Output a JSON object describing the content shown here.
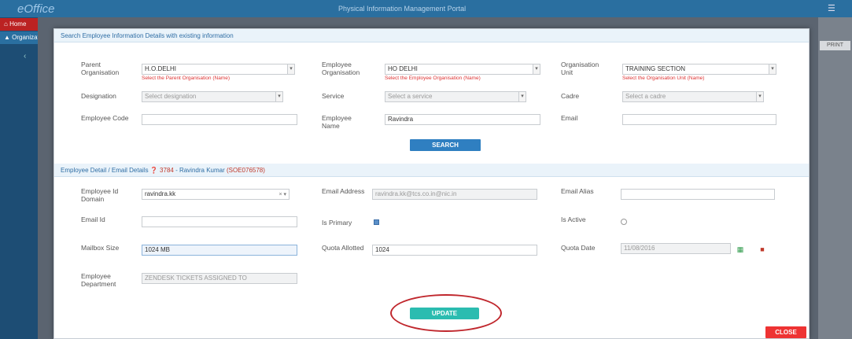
{
  "app": {
    "logo": "eOffice",
    "title": "Physical Information Management Portal",
    "user": "",
    "menu_icon": "hamburger-icon"
  },
  "sidebar": {
    "items": [
      {
        "label": "Home",
        "icon": "home-icon"
      },
      {
        "label": "Organization",
        "icon": "org-icon"
      }
    ]
  },
  "right_strip": {
    "button": "PRINT"
  },
  "search_section": {
    "header": "Search Employee Information Details with existing information",
    "fields": {
      "parent_org_label": "Parent Organisation",
      "parent_org_value": "H.O.DELHI",
      "parent_org_error": "Select the Parent Organisation (Name)",
      "emp_org_label": "Employee Organisation",
      "emp_org_value": "HO DELHI",
      "emp_org_error": "Select the Employee Organisation (Name)",
      "org_unit_label": "Organisation Unit",
      "org_unit_value": "TRAINING SECTION",
      "org_unit_error": "Select the Organisation Unit (Name)",
      "designation_label": "Designation",
      "designation_placeholder": "Select designation",
      "service_label": "Service",
      "service_placeholder": "Select a service",
      "cadre_label": "Cadre",
      "cadre_placeholder": "Select a cadre",
      "emp_code_label": "Employee Code",
      "emp_code_value": "",
      "emp_name_label": "Employee Name",
      "emp_name_value": "Ravindra",
      "email_label": "Email",
      "email_value": ""
    },
    "search_button": "SEARCH"
  },
  "details_section": {
    "header_prefix": "Employee Detail / Email Details",
    "header_id": "3784",
    "header_name": "Ravindra Kumar",
    "header_code": "(SOE076578)",
    "fields": {
      "emp_id_label": "Employee Id Domain",
      "emp_id_value": "ravindra.kk",
      "email_address_label": "Email Address",
      "email_address_value": "ravindra.kk@tcs.co.in@nic.in",
      "email_alias_label": "Email Alias",
      "email_alias_value": "",
      "email_id_label": "Email Id",
      "email_id_value": "",
      "is_primary_label": "Is Primary",
      "is_active_label": "Is Active",
      "mailbox_label": "Mailbox Size",
      "mailbox_value": "1024 MB",
      "quota_label": "Quota Allotted",
      "quota_value": "1024",
      "date_label": "Quota Date",
      "date_value": "11/08/2016",
      "upload_label": "Employee Department",
      "upload_value": "ZENDESK TICKETS ASSIGNED TO"
    },
    "update_button": "UPDATE"
  },
  "close_button": "CLOSE"
}
